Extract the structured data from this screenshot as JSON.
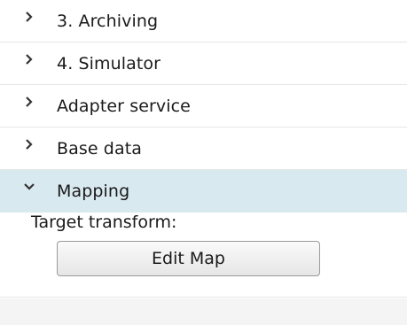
{
  "accordion": {
    "items": [
      {
        "label": "3. Archiving",
        "icon": "chevron-right-icon",
        "expanded": false
      },
      {
        "label": "4. Simulator",
        "icon": "chevron-right-icon",
        "expanded": false
      },
      {
        "label": "Adapter service",
        "icon": "chevron-right-icon",
        "expanded": false
      },
      {
        "label": "Base data",
        "icon": "chevron-right-icon",
        "expanded": false
      },
      {
        "label": "Mapping",
        "icon": "chevron-down-icon",
        "expanded": true
      }
    ]
  },
  "mapping": {
    "target_transform_label": "Target transform:",
    "edit_map_label": "Edit Map"
  },
  "colors": {
    "expanded_header_bg": "#d9e9f0",
    "divider": "#e6e6e6",
    "footer_bg": "#f4f4f4"
  }
}
